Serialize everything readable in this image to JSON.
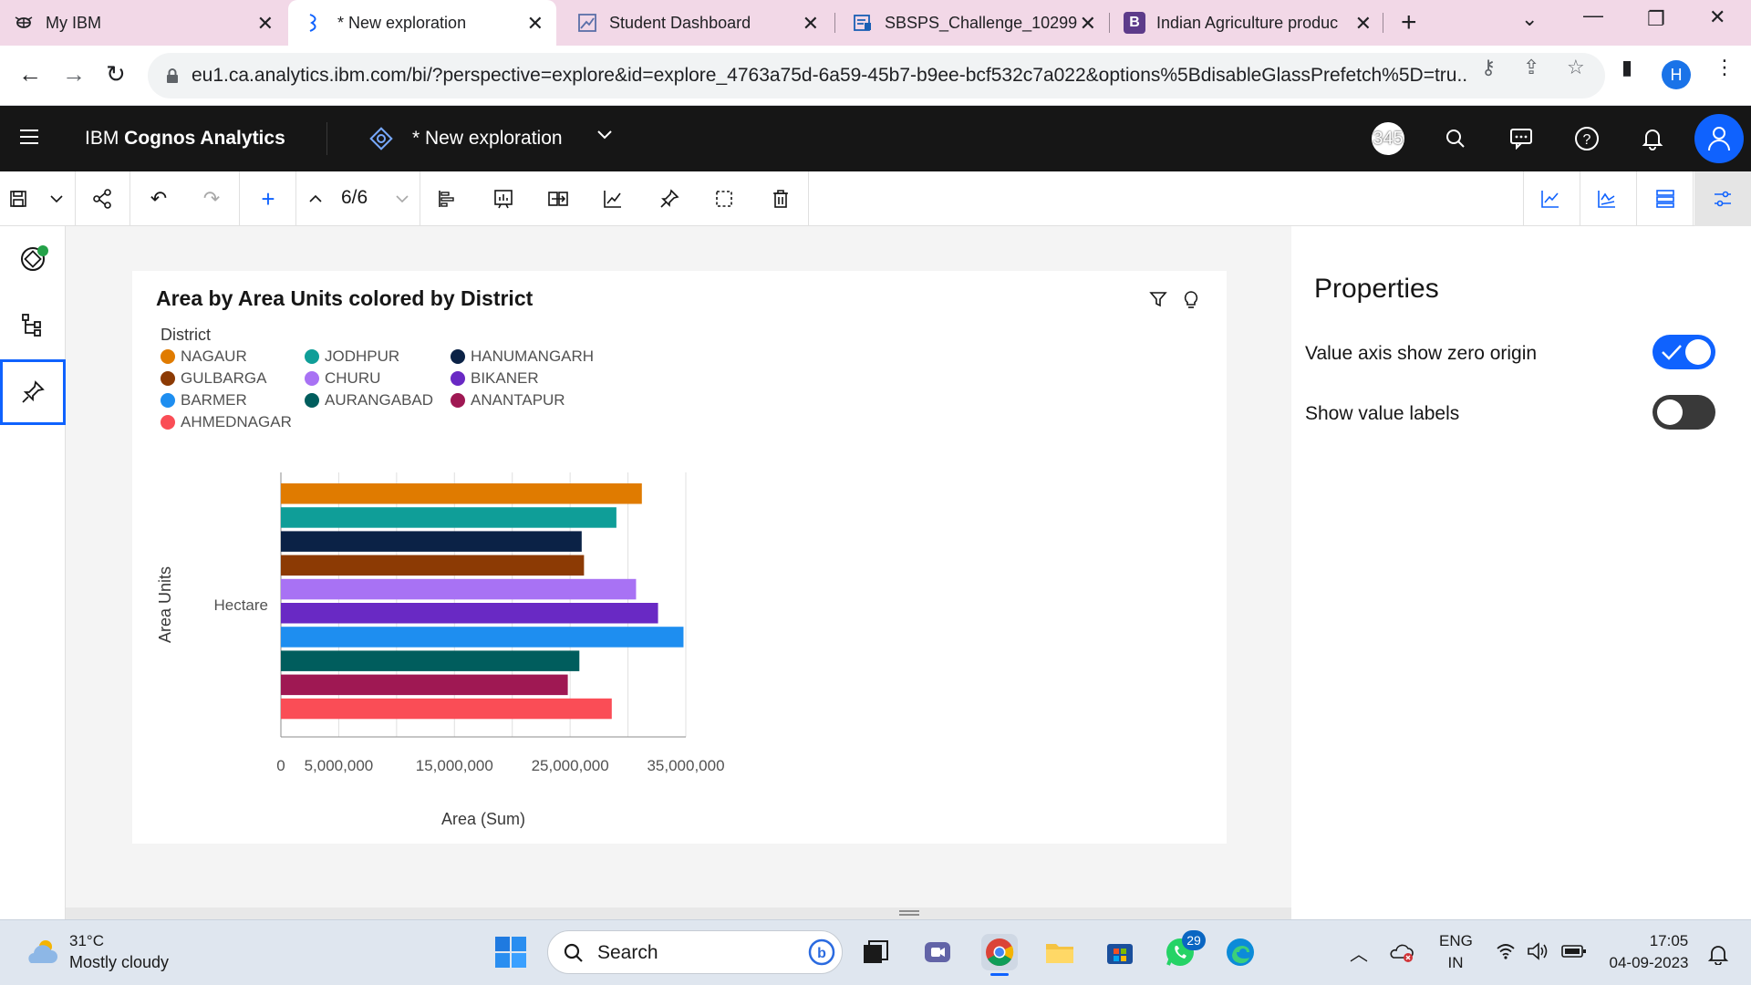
{
  "browser": {
    "tabs": [
      {
        "title": "My IBM",
        "icon": "ibm-bee-icon"
      },
      {
        "title": "* New exploration",
        "icon": "exploration-icon"
      },
      {
        "title": "Student Dashboard",
        "icon": "dashboard-icon"
      },
      {
        "title": "SBSPS_Challenge_10299",
        "icon": "document-icon"
      },
      {
        "title": "Indian Agriculture produc",
        "icon": "b-icon"
      }
    ],
    "url": "eu1.ca.analytics.ibm.com/bi/?perspective=explore&id=explore_4763a75d-6a59-45b7-b9ee-bcf532c7a022&options%5BdisableGlassPrefetch%5D=tru...",
    "profile_initial": "H"
  },
  "header": {
    "app_name_prefix": "IBM ",
    "app_name_bold": "Cognos Analytics",
    "exploration_title": "* New exploration",
    "notification_count": "345"
  },
  "toolbar": {
    "page_indicator": "6/6"
  },
  "chart_card": {
    "title": "Area by Area Units colored by District",
    "legend_title": "District"
  },
  "chart_data": {
    "type": "bar",
    "orientation": "horizontal",
    "title": "Area by Area Units colored by District",
    "xlabel": "Area (Sum)",
    "ylabel": "Area Units",
    "categories": [
      "Hectare"
    ],
    "xlim": [
      0,
      35000000
    ],
    "x_ticks": [
      "0",
      "5,000,000",
      "15,000,000",
      "25,000,000",
      "35,000,000"
    ],
    "x_tick_values": [
      0,
      5000000,
      15000000,
      25000000,
      35000000
    ],
    "grid": true,
    "legend_position": "top-left",
    "series": [
      {
        "name": "NAGAUR",
        "values": [
          31200000
        ],
        "color": "#e07b00"
      },
      {
        "name": "JODHPUR",
        "values": [
          29000000
        ],
        "color": "#0f9e98"
      },
      {
        "name": "HANUMANGARH",
        "values": [
          26000000
        ],
        "color": "#0b2246"
      },
      {
        "name": "GULBARGA",
        "values": [
          26200000
        ],
        "color": "#8c3a04"
      },
      {
        "name": "CHURU",
        "values": [
          30700000
        ],
        "color": "#a872f4"
      },
      {
        "name": "BIKANER",
        "values": [
          32600000
        ],
        "color": "#6929c4"
      },
      {
        "name": "BARMER",
        "values": [
          34800000
        ],
        "color": "#1e8ef0"
      },
      {
        "name": "AURANGABAD",
        "values": [
          25800000
        ],
        "color": "#005d5d"
      },
      {
        "name": "ANANTAPUR",
        "values": [
          24800000
        ],
        "color": "#9f1853"
      },
      {
        "name": "AHMEDNAGAR",
        "values": [
          28600000
        ],
        "color": "#fa4d56"
      }
    ]
  },
  "legend": [
    {
      "label": "NAGAUR",
      "color": "#e07b00"
    },
    {
      "label": "JODHPUR",
      "color": "#0f9e98"
    },
    {
      "label": "HANUMANGARH",
      "color": "#0b2246"
    },
    {
      "label": "GULBARGA",
      "color": "#8c3a04"
    },
    {
      "label": "CHURU",
      "color": "#a872f4"
    },
    {
      "label": "BIKANER",
      "color": "#6929c4"
    },
    {
      "label": "BARMER",
      "color": "#1e8ef0"
    },
    {
      "label": "AURANGABAD",
      "color": "#005d5d"
    },
    {
      "label": "ANANTAPUR",
      "color": "#9f1853"
    },
    {
      "label": "AHMEDNAGAR",
      "color": "#fa4d56"
    }
  ],
  "properties": {
    "title": "Properties",
    "items": [
      {
        "label": "Value axis show zero origin",
        "enabled": true
      },
      {
        "label": "Show value labels",
        "enabled": false
      }
    ]
  },
  "taskbar": {
    "weather_temp": "31°C",
    "weather_desc": "Mostly cloudy",
    "search_placeholder": "Search",
    "whatsapp_badge": "29",
    "lang_top": "ENG",
    "lang_bottom": "IN",
    "time": "17:05",
    "date": "04-09-2023"
  },
  "colors": {
    "accent": "#0f62fe",
    "header_bg": "#161616",
    "tab_strip_bg": "#f2d8e7"
  }
}
